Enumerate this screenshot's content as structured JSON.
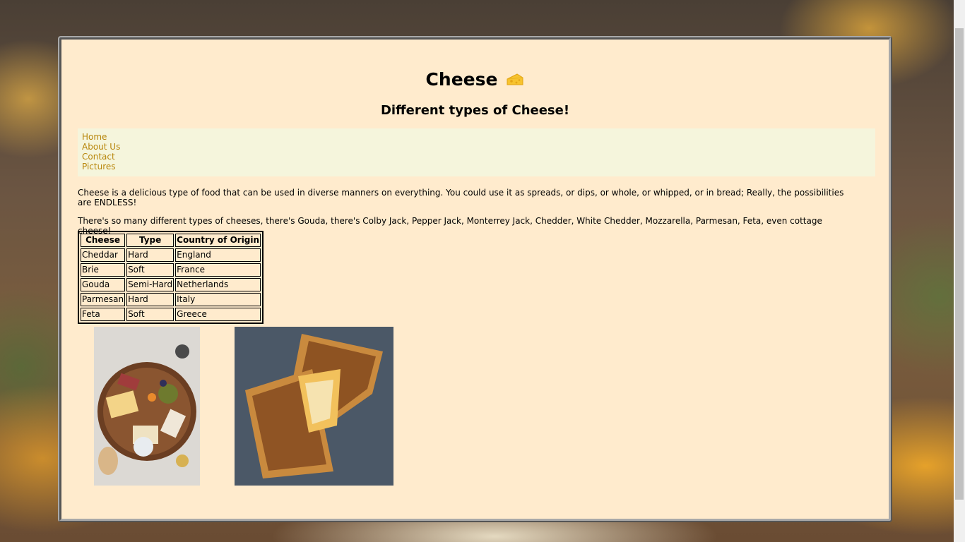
{
  "header": {
    "title": "Cheese",
    "subtitle": "Different types of Cheese!"
  },
  "nav": {
    "items": [
      "Home",
      "About Us",
      "Contact",
      "Pictures"
    ]
  },
  "content": {
    "paragraph1": "Cheese is a delicious type of food that can be used in diverse manners on everything. You could use it as spreads, or dips, or whole, or whipped, or in bread; Really, the possibilities are ENDLESS!",
    "paragraph2": "There's so many different types of cheeses, there's Gouda, there's Colby Jack, Pepper Jack, Monterrey Jack, Chedder, White Chedder, Mozzarella, Parmesan, Feta, even cottage cheese!"
  },
  "table": {
    "headers": [
      "Cheese",
      "Type",
      "Country of Origin"
    ],
    "rows": [
      [
        "Cheddar",
        "Hard",
        "England"
      ],
      [
        "Brie",
        "Soft",
        "France"
      ],
      [
        "Gouda",
        "Semi-Hard",
        "Netherlands"
      ],
      [
        "Parmesan",
        "Hard",
        "Italy"
      ],
      [
        "Feta",
        "Soft",
        "Greece"
      ]
    ]
  },
  "images": {
    "image1": "charcuterie-board-photo",
    "image2": "grilled-cheese-sandwich-photo"
  },
  "colors": {
    "card_background": "#ffebcd",
    "nav_background": "#f5f5dc",
    "link": "#b8860b"
  }
}
